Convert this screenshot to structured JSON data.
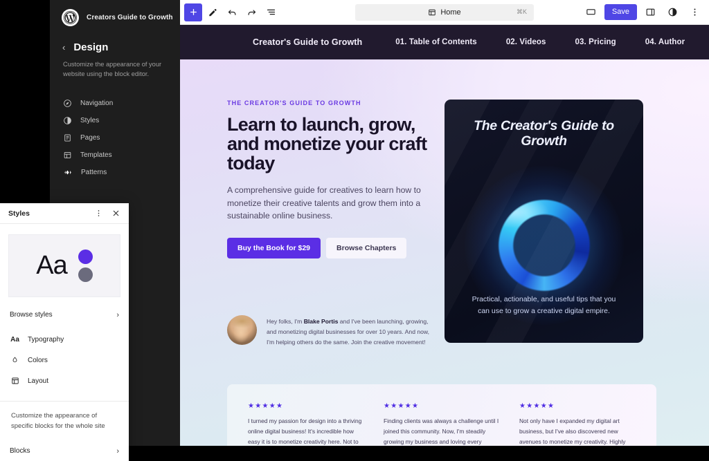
{
  "toolbar": {
    "add_block_label": "+",
    "tools": [
      "add-block",
      "edit-pencil",
      "undo",
      "redo",
      "list-view"
    ],
    "command_bar": {
      "label": "Home",
      "shortcut": "⌘K",
      "icon": "layout-icon"
    },
    "save_label": "Save",
    "right_icons": [
      "desktop-icon",
      "sidebar-icon",
      "contrast-icon",
      "more-options-icon"
    ]
  },
  "sidebar": {
    "site_name": "Creators Guide to Growth",
    "back_label": "‹",
    "title": "Design",
    "description": "Customize the appearance of your website using the block editor.",
    "items": [
      {
        "label": "Navigation",
        "icon": "compass-icon"
      },
      {
        "label": "Styles",
        "icon": "contrast-icon"
      },
      {
        "label": "Pages",
        "icon": "page-icon"
      },
      {
        "label": "Templates",
        "icon": "template-icon"
      },
      {
        "label": "Patterns",
        "icon": "patterns-icon"
      }
    ]
  },
  "styles_panel": {
    "title": "Styles",
    "more_icon": "kebab-menu-icon",
    "close_icon": "close-icon",
    "preview_text": "Aa",
    "preview_dot_1": "#5b2ee5",
    "preview_dot_2": "#6b6b7d",
    "browse_styles": "Browse styles",
    "items": [
      {
        "label": "Typography",
        "icon": "typography-icon",
        "glyph": "Aa"
      },
      {
        "label": "Colors",
        "icon": "color-drop-icon",
        "glyph": "◇"
      },
      {
        "label": "Layout",
        "icon": "layout-icon",
        "glyph": "▣"
      }
    ],
    "note": "Customize the appearance of specific blocks for the whole site",
    "blocks_label": "Blocks",
    "chevron": "›"
  },
  "site": {
    "brand": "Creator's Guide to Growth",
    "nav": [
      "01. Table of Contents",
      "02. Videos",
      "03. Pricing",
      "04. Author"
    ],
    "nav_bg": "#211a2e"
  },
  "hero": {
    "eyebrow": "THE CREATOR'S GUIDE TO GROWTH",
    "title": "Learn to launch, grow, and monetize your craft today",
    "subtitle": "A comprehensive guide for creatives to learn how to monetize their creative talents and grow them into a sustainable online business.",
    "primary_button": "Buy the Book for $29",
    "secondary_button": "Browse Chapters",
    "accent_color": "#5b2ee5"
  },
  "author": {
    "intro": "Hey folks, I'm ",
    "name": "Blake Portis",
    "rest": " and I've been launching, growing, and monetizing digital businesses for over 10 years. And now, I'm helping others do the same. Join the creative movement!"
  },
  "book": {
    "title": "The Creator's Guide to Growth",
    "tagline": "Practical, actionable, and useful tips that you can use to grow a creative digital empire.",
    "art": "blue-torus-ring"
  },
  "testimonials": {
    "stars": "★★★★★",
    "items": [
      "I turned my passion for design into a thriving online digital business! It's incredible how easy it is to monetize creativity here. Not to mention",
      "Finding clients was always a challenge until I joined this community. Now, I'm steadily growing my business and loving every",
      "Not only have I expanded my digital art business, but I've also discovered new avenues to monetize my creativity. Highly recommend"
    ]
  }
}
